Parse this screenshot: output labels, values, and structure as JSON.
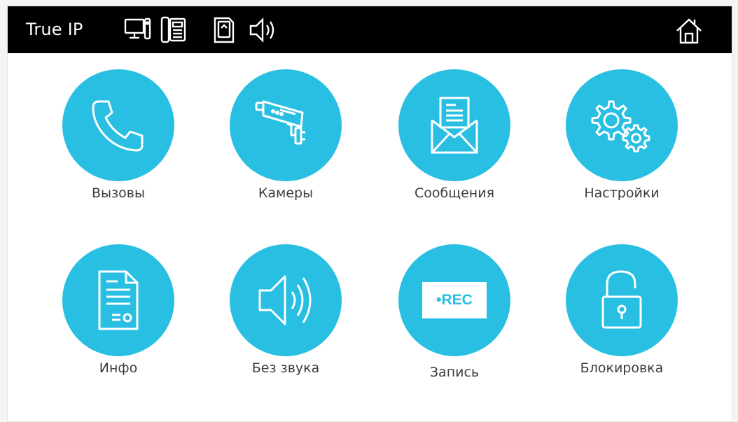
{
  "app": {
    "brand": "True IP"
  },
  "status_icons": [
    "monitor-icon",
    "intercom-icon",
    "sd-card-icon",
    "speaker-icon"
  ],
  "home": {
    "icon": "home-icon"
  },
  "accent_color": "#29bfe3",
  "tiles": [
    {
      "label": "Вызовы",
      "icon": "phone-icon"
    },
    {
      "label": "Камеры",
      "icon": "camera-icon"
    },
    {
      "label": "Сообщения",
      "icon": "envelope-icon"
    },
    {
      "label": "Настройки",
      "icon": "gears-icon"
    },
    {
      "label": "Инфо",
      "icon": "document-icon"
    },
    {
      "label": "Без звука",
      "icon": "speaker-icon"
    },
    {
      "label": "Запись",
      "icon": "rec-icon",
      "badge": "•REC"
    },
    {
      "label": "Блокировка",
      "icon": "unlock-icon"
    }
  ]
}
